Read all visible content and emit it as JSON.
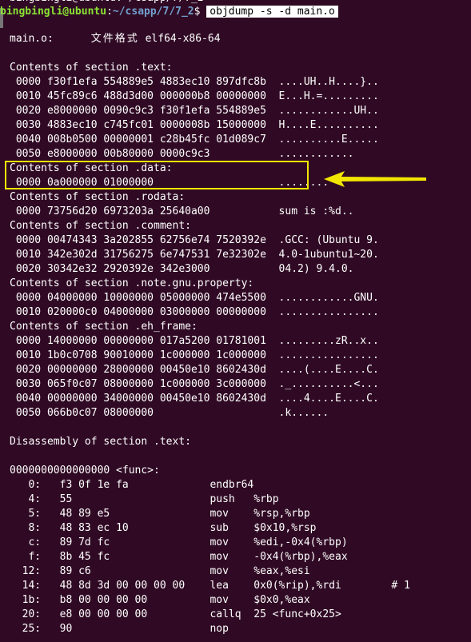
{
  "prompt": {
    "user_host": "bingbingli@ubuntu",
    "path": "~/csapp/7/7_2",
    "symbol": "$",
    "command": "objdump -s -d main.o"
  },
  "header": {
    "file": "main.o:",
    "format_label": "文件格式",
    "format": "elf64-x86-64"
  },
  "lines": [
    {
      "t": "Contents of section .text:"
    },
    {
      "t": " 0000 f30f1efa 554889e5 4883ec10 897dfc8b  ....UH..H....}.."
    },
    {
      "t": " 0010 45fc89c6 488d3d00 000000b8 00000000  E...H.=........."
    },
    {
      "t": " 0020 e8000000 0090c9c3 f30f1efa 554889e5  ............UH.."
    },
    {
      "t": " 0030 4883ec10 c745fc01 0000008b 15000000  H....E.........."
    },
    {
      "t": " 0040 008b0500 00000001 c28b45fc 01d089c7  ..........E....."
    },
    {
      "t": " 0050 e8000000 00b80000 0000c9c3           ............"
    },
    {
      "t": "Contents of section .data:"
    },
    {
      "t": " 0000 0a000000 01000000                    ........"
    },
    {
      "t": "Contents of section .rodata:"
    },
    {
      "t": " 0000 73756d20 6973203a 25640a00           sum is :%d.."
    },
    {
      "t": "Contents of section .comment:"
    },
    {
      "t": " 0000 00474343 3a202855 62756e74 7520392e  .GCC: (Ubuntu 9."
    },
    {
      "t": " 0010 342e302d 31756275 6e747531 7e32302e  4.0-1ubuntu1~20."
    },
    {
      "t": " 0020 30342e32 2920392e 342e3000           04.2) 9.4.0."
    },
    {
      "t": "Contents of section .note.gnu.property:"
    },
    {
      "t": " 0000 04000000 10000000 05000000 474e5500  ............GNU."
    },
    {
      "t": " 0010 020000c0 04000000 03000000 00000000  ................"
    },
    {
      "t": "Contents of section .eh_frame:"
    },
    {
      "t": " 0000 14000000 00000000 017a5200 01781001  .........zR..x.."
    },
    {
      "t": " 0010 1b0c0708 90010000 1c000000 1c000000  ................"
    },
    {
      "t": " 0020 00000000 28000000 00450e10 8602430d  ....(....E....C."
    },
    {
      "t": " 0030 065f0c07 08000000 1c000000 3c000000  ._..........<..."
    },
    {
      "t": " 0040 00000000 34000000 00450e10 8602430d  ....4....E....C."
    },
    {
      "t": " 0050 066b0c07 08000000                    .k......"
    },
    {
      "t": ""
    },
    {
      "t": "Disassembly of section .text:"
    },
    {
      "t": ""
    },
    {
      "t": "0000000000000000 <func>:"
    },
    {
      "t": "   0:\tf3 0f 1e fa          \tendbr64"
    },
    {
      "t": "   4:\t55                   \tpush   %rbp"
    },
    {
      "t": "   5:\t48 89 e5             \tmov    %rsp,%rbp"
    },
    {
      "t": "   8:\t48 83 ec 10          \tsub    $0x10,%rsp"
    },
    {
      "t": "   c:\t89 7d fc             \tmov    %edi,-0x4(%rbp)"
    },
    {
      "t": "   f:\t8b 45 fc             \tmov    -0x4(%rbp),%eax"
    },
    {
      "t": "  12:\t89 c6                \tmov    %eax,%esi"
    },
    {
      "t": "  14:\t48 8d 3d 00 00 00 00 \tlea    0x0(%rip),%rdi        # 1"
    },
    {
      "t": "  1b:\tb8 00 00 00 00       \tmov    $0x0,%eax"
    },
    {
      "t": "  20:\te8 00 00 00 00       \tcallq  25 <func+0x25>"
    },
    {
      "t": "  25:\t90                   \tnop"
    }
  ],
  "colors": {
    "background": "#300a24",
    "prompt_user": "#8ae234",
    "prompt_path": "#729fcf",
    "highlight": "#f2e600"
  }
}
